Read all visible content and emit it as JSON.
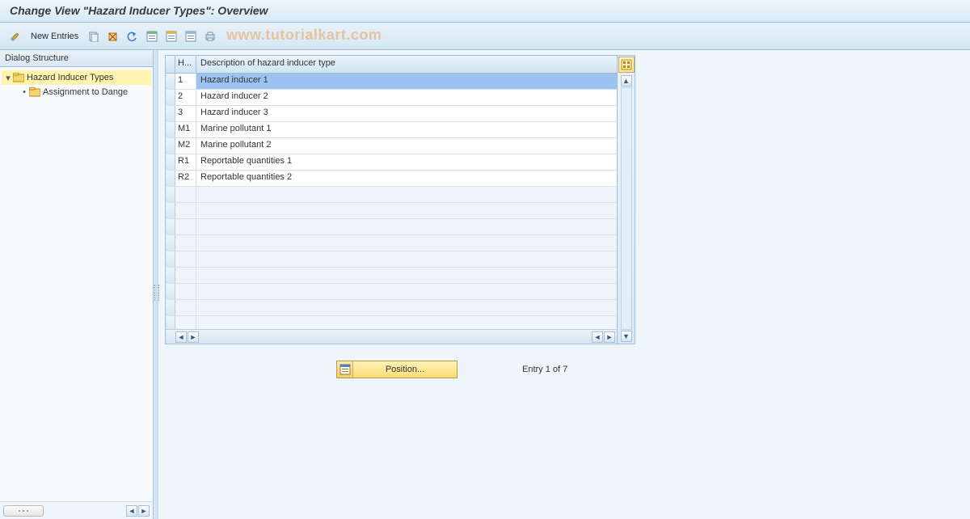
{
  "title": "Change View \"Hazard Inducer Types\": Overview",
  "toolbar": {
    "new_entries": "New Entries"
  },
  "watermark": "www.tutorialkart.com",
  "dialog_structure": {
    "header": "Dialog Structure",
    "root": "Hazard Inducer Types",
    "child": "Assignment to Dange"
  },
  "table": {
    "col1": "H...",
    "col2": "Description of hazard inducer type",
    "rows": [
      {
        "code": "1",
        "desc": "Hazard inducer 1"
      },
      {
        "code": "2",
        "desc": "Hazard inducer 2"
      },
      {
        "code": "3",
        "desc": "Hazard inducer 3"
      },
      {
        "code": "M1",
        "desc": "Marine pollutant 1"
      },
      {
        "code": "M2",
        "desc": "Marine pollutant 2"
      },
      {
        "code": "R1",
        "desc": "Reportable quantities 1"
      },
      {
        "code": "R2",
        "desc": "Reportable quantities 2"
      }
    ]
  },
  "footer": {
    "position": "Position...",
    "entry_status": "Entry 1 of 7"
  }
}
